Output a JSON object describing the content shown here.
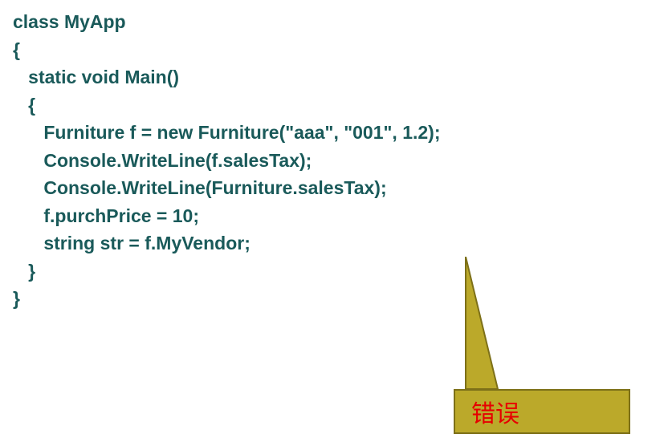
{
  "code": {
    "line1": "class MyApp",
    "line2": "{",
    "line3": "   static void Main()",
    "line4": "   {",
    "line5": "      Furniture f = new Furniture(\"aaa\", \"001\", 1.2);",
    "line6": "      Console.WriteLine(f.salesTax);",
    "line7": "      Console.WriteLine(Furniture.salesTax);",
    "line8": "      f.purchPrice = 10;",
    "line9": "      string str = f.MyVendor;",
    "line10": "   }",
    "line11": "}"
  },
  "callout": {
    "label": "错误"
  },
  "colors": {
    "codeText": "#1a5a5a",
    "calloutBg": "#bba92a",
    "calloutBorder": "#7d7018",
    "calloutText": "#e60000"
  }
}
